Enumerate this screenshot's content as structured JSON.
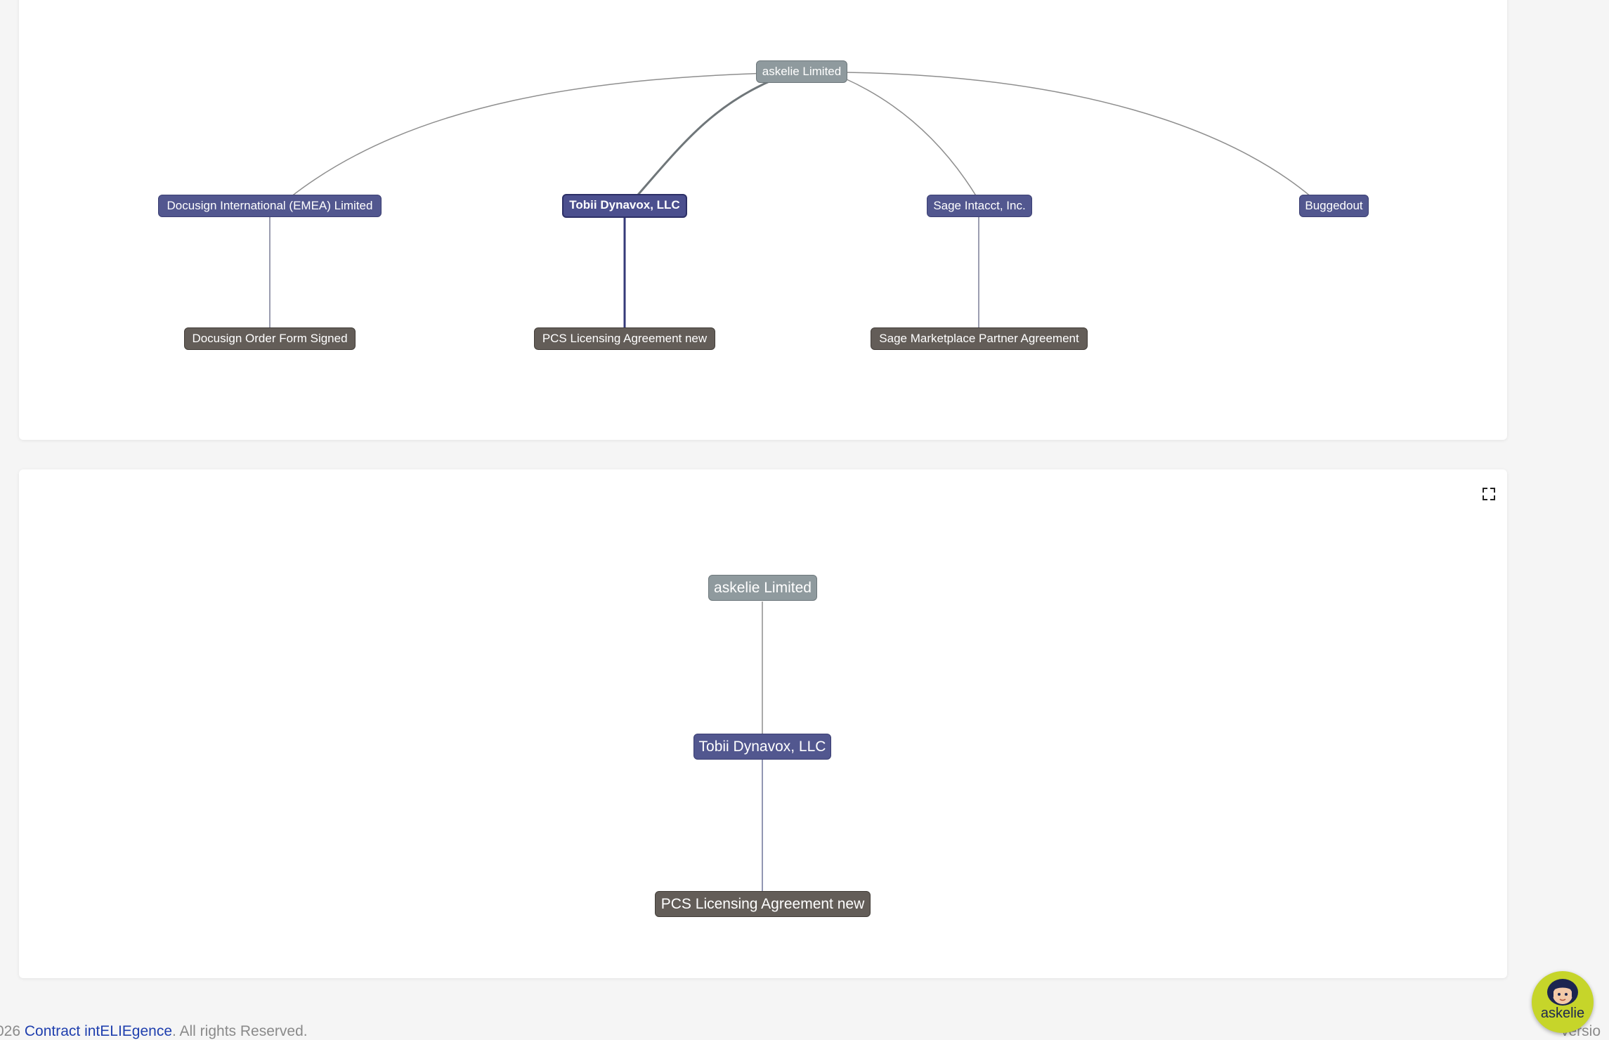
{
  "graph_top": {
    "root": "askelie Limited",
    "companies": [
      "Docusign International (EMEA) Limited",
      "Tobii Dynavox, LLC",
      "Sage Intacct, Inc.",
      "Buggedout"
    ],
    "contracts": [
      "Docusign Order Form Signed",
      "PCS Licensing Agreement new",
      "Sage Marketplace Partner Agreement"
    ],
    "selected_company": "Tobii Dynavox, LLC"
  },
  "graph_bottom": {
    "root": "askelie Limited",
    "company": "Tobii Dynavox, LLC",
    "contract": "PCS Licensing Agreement new",
    "expand_icon": "fullscreen-icon"
  },
  "footer": {
    "prefix": "026 ",
    "link": "Contract intELIEgence",
    "suffix": ". All rights Reserved.",
    "version_fragment": "versio"
  },
  "assistant": {
    "label": "askelie",
    "icon": "assistant-avatar-icon"
  },
  "colors": {
    "root_node": "#8f9a9e",
    "company_node": "#52578f",
    "contract_node": "#635d58",
    "link": "#1f3fae",
    "assistant_bg": "#c6d52a"
  }
}
